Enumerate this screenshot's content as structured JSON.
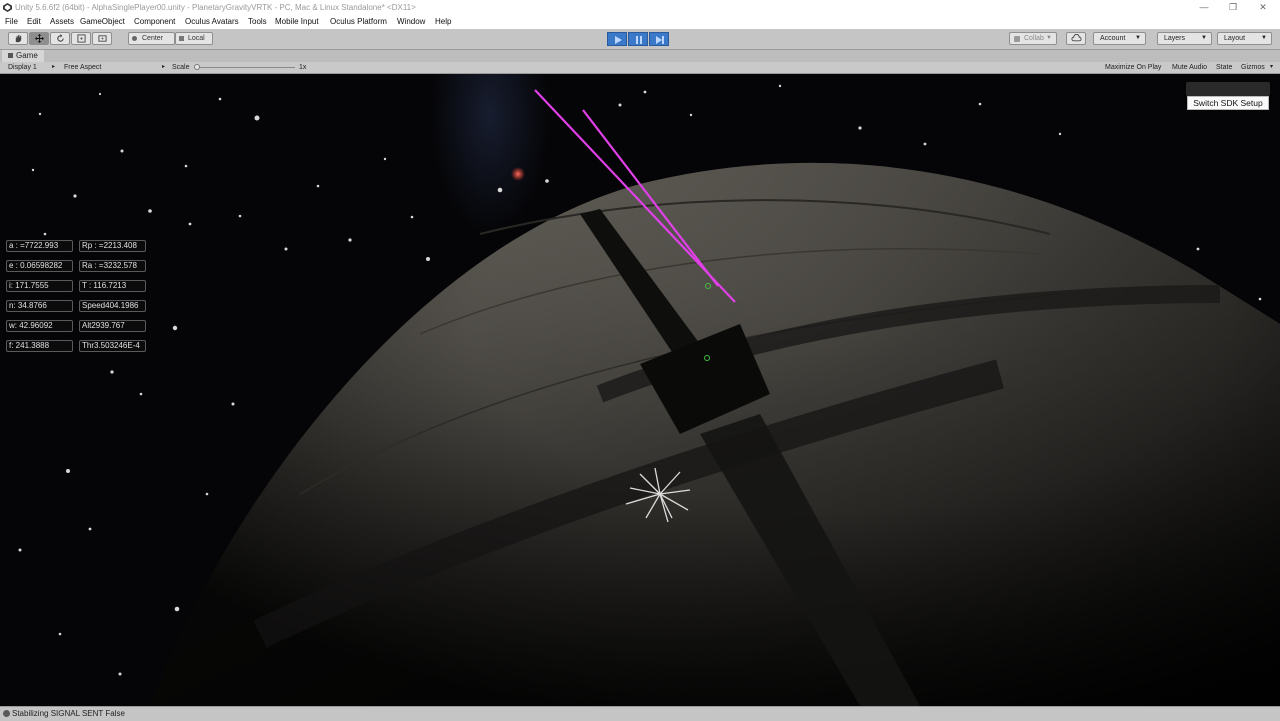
{
  "window": {
    "title": "Unity 5.6.6f2 (64bit) - AlphaSinglePlayer00.unity - PlanetaryGravityVRTK - PC, Mac & Linux Standalone* <DX11>",
    "controls": [
      "—",
      "❐",
      "✕"
    ]
  },
  "menu": {
    "items": [
      "File",
      "Edit",
      "Assets",
      "GameObject",
      "Component",
      "Oculus Avatars",
      "Tools",
      "Mobile Input",
      "Oculus Platform",
      "Window",
      "Help"
    ]
  },
  "toolbar": {
    "pivot_label": "Center",
    "space_label": "Local",
    "collab_label": "Collab",
    "account_label": "Account",
    "layers_label": "Layers",
    "layout_label": "Layout",
    "accent": "#3a78c9"
  },
  "game_view": {
    "tab_label": "Game",
    "display": "Display 1",
    "aspect": "Free Aspect",
    "scale_label": "Scale",
    "scale_value": "1x",
    "maximize_label": "Maximize On Play",
    "mute_label": "Mute Audio",
    "stats_label": "State",
    "gizmos_label": "Gizmos"
  },
  "orbit_fields": [
    {
      "text": "a : =7722.993"
    },
    {
      "text": "Rp : =2213.408"
    },
    {
      "text": "e : 0.06598282"
    },
    {
      "text": "Ra : =3232.578"
    },
    {
      "text": "i: 171.7555"
    },
    {
      "text": "T : 116.7213"
    },
    {
      "text": "n: 34.8766"
    },
    {
      "text": "Speed404.1986"
    },
    {
      "text": "w: 42.96092"
    },
    {
      "text": "Alt2939.767"
    },
    {
      "text": "f: 241.3888"
    },
    {
      "text": "Thr3.503246E-4"
    }
  ],
  "sdk_button_label": "Switch SDK Setup",
  "status": {
    "text": "Stabilizing SIGNAL SENT False"
  },
  "colors": {
    "laser": "#e040e8",
    "planet": "#8a857c",
    "space": "#050507"
  }
}
